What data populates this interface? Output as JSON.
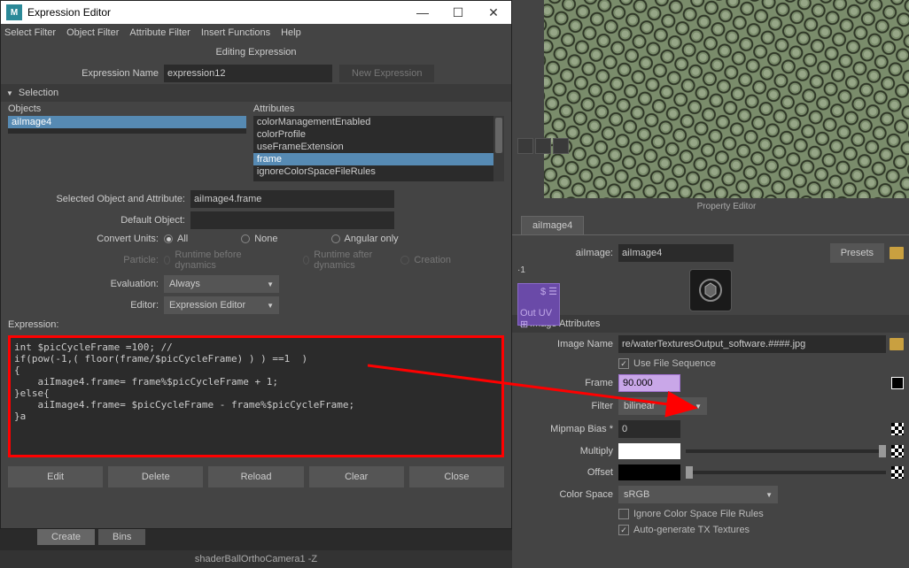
{
  "window": {
    "title": "Expression Editor",
    "menus": [
      "Select Filter",
      "Object Filter",
      "Attribute Filter",
      "Insert Functions",
      "Help"
    ],
    "heading": "Editing Expression"
  },
  "expr": {
    "name_label": "Expression Name",
    "name_value": "expression12",
    "new_btn": "New Expression",
    "section": "Selection",
    "objects_label": "Objects",
    "attributes_label": "Attributes",
    "objects": [
      "aiImage4"
    ],
    "attributes": [
      "colorManagementEnabled",
      "colorProfile",
      "useFrameExtension",
      "frame",
      "ignoreColorSpaceFileRules"
    ],
    "attr_selected": 3,
    "sel_attr_label": "Selected Object and Attribute:",
    "sel_attr_value": "aiImage4.frame",
    "def_obj_label": "Default Object:",
    "conv_label": "Convert Units:",
    "conv_opts": [
      "All",
      "None",
      "Angular only"
    ],
    "particle_label": "Particle:",
    "particle_opts": [
      "Runtime before dynamics",
      "Runtime after dynamics",
      "Creation"
    ],
    "eval_label": "Evaluation:",
    "eval_value": "Always",
    "editor_label": "Editor:",
    "editor_value": "Expression Editor",
    "expr_title": "Expression:",
    "code": "int $picCycleFrame =100; //\nif(pow(-1,( floor(frame/$picCycleFrame) ) ) ==1  )\n{\n    aiImage4.frame= frame%$picCycleFrame + 1;\n}else{\n    aiImage4.frame= $picCycleFrame - frame%$picCycleFrame;\n}a",
    "buttons": [
      "Edit",
      "Delete",
      "Reload",
      "Clear",
      "Close"
    ]
  },
  "prop": {
    "title": "Property Editor",
    "tab": "aiImage4",
    "ai_label": "aiImage:",
    "ai_value": "aiImage4",
    "presets": "Presets",
    "section": "Image Attributes",
    "img_name_label": "Image Name",
    "img_name_value": "re/waterTexturesOutput_software.####.jpg",
    "use_seq": "Use File Sequence",
    "frame_label": "Frame",
    "frame_value": "90.000",
    "filter_label": "Filter",
    "filter_value": "bilinear",
    "mip_label": "Mipmap Bias *",
    "mip_value": "0",
    "mult_label": "Multiply",
    "off_label": "Offset",
    "cs_label": "Color Space",
    "cs_value": "sRGB",
    "ignore_cs": "Ignore Color Space File Rules",
    "auto_tx": "Auto-generate TX Textures"
  },
  "bottom": {
    "tabs": [
      "Create",
      "Bins"
    ],
    "status": "shaderBallOrthoCamera1 -Z"
  },
  "purple": {
    "l1": "$  ☰",
    "l2": "Out UV ⊞"
  }
}
